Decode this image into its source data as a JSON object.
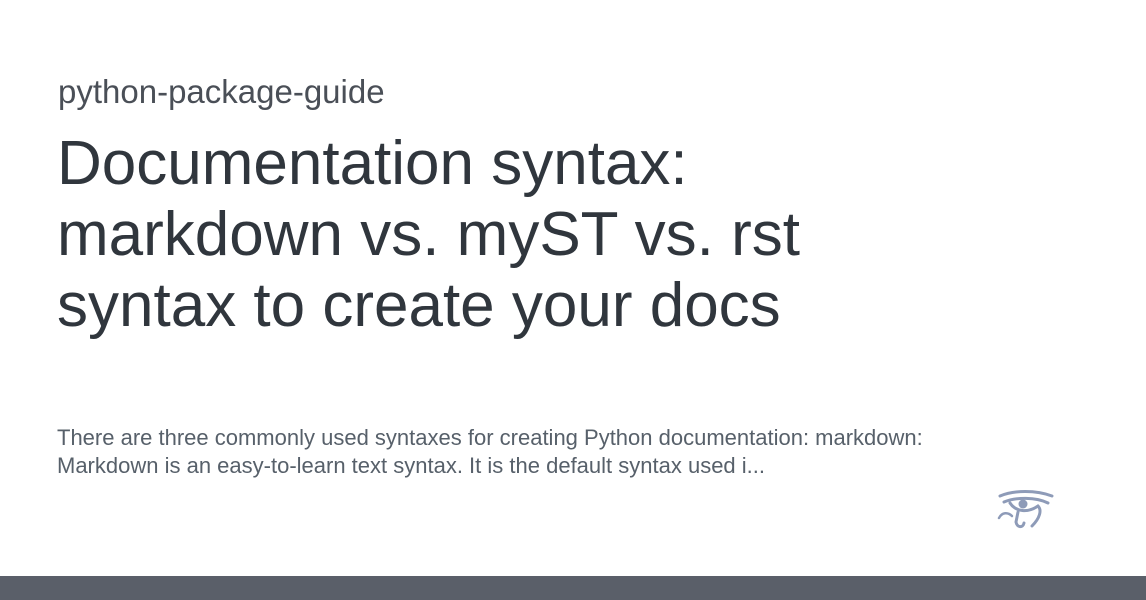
{
  "card": {
    "site_name": "python-package-guide",
    "title": "Documentation syntax: markdown vs. myST vs. rst syntax to create your docs",
    "description": "There are three commonly used syntaxes for creating Python documentation: markdown: Markdown is an easy-to-learn text syntax. It is the default syntax used i...",
    "logo_icon": "eye-of-horus-icon",
    "footer_color": "#5a5f69",
    "logo_color": "#8e9bb8"
  }
}
